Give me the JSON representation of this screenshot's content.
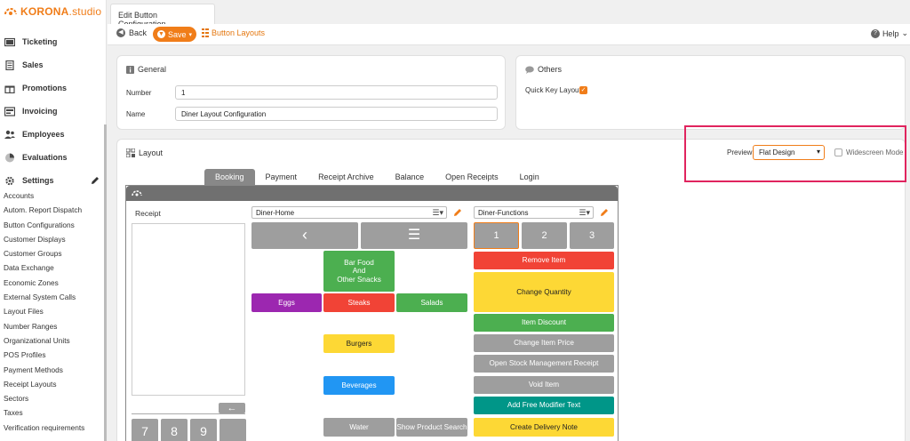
{
  "app": {
    "logo_brand": "KORONA",
    "logo_suffix": ".studio"
  },
  "sidebar": {
    "main_items": [
      {
        "label": "Ticketing",
        "icon": "ticket-icon"
      },
      {
        "label": "Sales",
        "icon": "receipt-icon"
      },
      {
        "label": "Promotions",
        "icon": "gift-icon"
      },
      {
        "label": "Invoicing",
        "icon": "invoice-icon"
      },
      {
        "label": "Employees",
        "icon": "users-icon"
      },
      {
        "label": "Evaluations",
        "icon": "pie-chart-icon"
      },
      {
        "label": "Settings",
        "icon": "gear-icon"
      }
    ],
    "sub_items": [
      "Accounts",
      "Autom. Report Dispatch",
      "Button Configurations",
      "Customer Displays",
      "Customer Groups",
      "Data Exchange",
      "Economic Zones",
      "External System Calls",
      "Layout Files",
      "Number Ranges",
      "Organizational Units",
      "POS Profiles",
      "Payment Methods",
      "Receipt Layouts",
      "Sectors",
      "Taxes",
      "Verification requirements"
    ]
  },
  "document_tab": "Edit Button Configuration",
  "toolbar": {
    "back": "Back",
    "save": "Save",
    "button_layouts": "Button Layouts",
    "help": "Help"
  },
  "general": {
    "title": "General",
    "number_label": "Number",
    "number_value": "1",
    "name_label": "Name",
    "name_value": "Diner Layout Configuration"
  },
  "others": {
    "title": "Others",
    "quick_key_label": "Quick Key Layout",
    "quick_key_checked": true
  },
  "layout": {
    "title": "Layout",
    "preview_label": "Preview",
    "preview_value": "Flat Design",
    "widescreen_label": "Widescreen Mode",
    "widescreen_checked": false,
    "tabs": [
      "Booking",
      "Payment",
      "Receipt Archive",
      "Balance",
      "Open Receipts",
      "Login"
    ],
    "active_tab": "Booking"
  },
  "pos": {
    "receipt_label": "Receipt",
    "left_select": "Diner-Home",
    "right_select": "Diner-Functions",
    "back_arrow": "←",
    "numpad": [
      "7",
      "8",
      "9"
    ],
    "nav_prev": "‹",
    "nav_menu": "☰",
    "home_buttons": {
      "bar_food": "Bar Food\nAnd\nOther Snacks",
      "eggs": "Eggs",
      "steaks": "Steaks",
      "salads": "Salads",
      "burgers": "Burgers",
      "beverages": "Beverages",
      "water": "Water",
      "show_product_search": "Show Product Search"
    },
    "function_numbers": [
      "1",
      "2",
      "3"
    ],
    "function_buttons": [
      "Remove Item",
      "Change Quantity",
      "Item Discount",
      "Change Item Price",
      "Open Stock Management Receipt",
      "Void Item",
      "Add Free Modifier Text",
      "Create Delivery Note"
    ]
  },
  "colors": {
    "brand_orange": "#f07d19",
    "highlight": "#e0245e",
    "red": "#f14336",
    "green": "#4caf50",
    "purple": "#9c27b0",
    "yellow": "#fdd835",
    "blue": "#2196f3",
    "teal": "#009688",
    "gray": "#9e9e9e"
  }
}
